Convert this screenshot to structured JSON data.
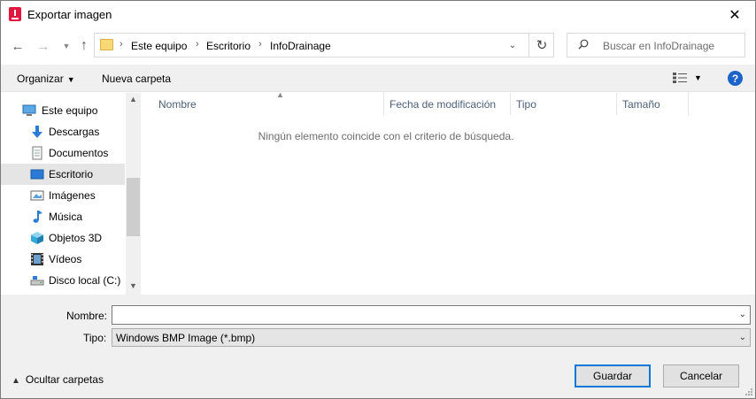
{
  "window": {
    "title": "Exportar imagen"
  },
  "navigation": {
    "breadcrumbs": [
      "Este equipo",
      "Escritorio",
      "InfoDrainage"
    ],
    "search_placeholder": "Buscar en InfoDrainage"
  },
  "toolbar": {
    "organize_label": "Organizar",
    "new_folder_label": "Nueva carpeta"
  },
  "sidebar": {
    "items": [
      {
        "label": "Este equipo",
        "icon": "computer-icon"
      },
      {
        "label": "Descargas",
        "icon": "download-icon"
      },
      {
        "label": "Documentos",
        "icon": "document-icon"
      },
      {
        "label": "Escritorio",
        "icon": "desktop-icon",
        "selected": true
      },
      {
        "label": "Imágenes",
        "icon": "pictures-icon"
      },
      {
        "label": "Música",
        "icon": "music-icon"
      },
      {
        "label": "Objetos 3D",
        "icon": "cube-icon"
      },
      {
        "label": "Vídeos",
        "icon": "video-icon"
      },
      {
        "label": "Disco local (C:)",
        "icon": "drive-icon"
      }
    ]
  },
  "filelist": {
    "columns": [
      "Nombre",
      "Fecha de modificación",
      "Tipo",
      "Tamaño"
    ],
    "empty_message": "Ningún elemento coincide con el criterio de búsqueda."
  },
  "form": {
    "name_label": "Nombre:",
    "name_value": "",
    "type_label": "Tipo:",
    "type_value": "Windows BMP Image (*.bmp)"
  },
  "footer": {
    "hide_folders_label": "Ocultar carpetas",
    "save_label": "Guardar",
    "cancel_label": "Cancelar"
  },
  "colors": {
    "accent": "#0078d7",
    "selection": "#e5e5e5",
    "app_icon": "#e2173f"
  }
}
